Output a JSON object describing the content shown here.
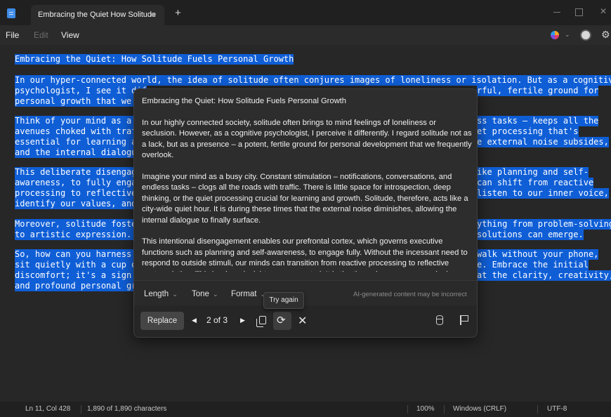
{
  "titlebar": {
    "tab_title": "Embracing the Quiet How Solitude",
    "new_tab": "+"
  },
  "menu": {
    "file": "File",
    "edit": "Edit",
    "view": "View"
  },
  "editor_lines": [
    "Embracing the Quiet: How Solitude Fuels Personal Growth",
    "In our hyper-connected world, the idea of solitude often conjures images of loneliness or isolation. But as a cognitive",
    "psychologist, I see it dif",
    "rful, fertile ground for",
    "personal growth that we t",
    "Think of your mind as a b",
    "ss tasks – keeps all the",
    "avenues choked with traf",
    "et processing that's",
    "essential for learning ar",
    "e external noise subsides,",
    "and the internal dialogue",
    "This deliberate disengag",
    "ike planning and self-",
    "awareness, to fully engag",
    "can shift from reactive",
    "processing to reflective",
    "listen to our inner voice,",
    "identify our values, and",
    "Moreover, solitude foster",
    "ything from problem-solving",
    "to artistic expression. I",
    "solutions can emerge.",
    "So, how can you harness t",
    "walk without your phone,",
    "sit quietly with a cup o",
    "e. Embrace the initial",
    "discomfort; it's a sign y",
    "at the clarity, creativity,",
    "and profound personal gro"
  ],
  "popup": {
    "title": "Embracing the Quiet: How Solitude Fuels Personal Growth",
    "paragraphs": [
      "In our highly connected society, solitude often brings to mind feelings of loneliness or seclusion. However, as a cognitive psychologist, I perceive it differently. I regard solitude not as a lack, but as a presence – a potent, fertile ground for personal development that we frequently overlook.",
      "Imagine your mind as a busy city. Constant stimulation – notifications, conversations, and endless tasks – clogs all the roads with traffic. There is little space for introspection, deep thinking, or the quiet processing crucial for learning and growth. Solitude, therefore, acts like a city-wide quiet hour. It is during these times that the external noise diminishes, allowing the internal dialogue to finally surface.",
      "This intentional disengagement enables our prefrontal cortex, which governs executive functions such as planning and self-awareness, to engage fully. Without the incessant need to respond to outside stimuli, our minds can transition from reactive processing to reflective contemplation. This is where insights are generated. It is the time when we can genuinely listen to our inner voice, recognize our values, and explore our emotions without judgment"
    ],
    "options": {
      "length": "Length",
      "tone": "Tone",
      "format": "Format"
    },
    "disclaimer": "AI-generated content may be incorrect",
    "replace_label": "Replace",
    "pager": "2 of 3",
    "tooltip": "Try again"
  },
  "status": {
    "position": "Ln 11, Col 428",
    "chars": "1,890 of 1,890 characters",
    "zoom": "100%",
    "line_ending": "Windows (CRLF)",
    "encoding": "UTF-8"
  },
  "colors": {
    "selection": "#0f5ed6",
    "background": "#272727",
    "accent_icon": "#3f8ce8"
  }
}
